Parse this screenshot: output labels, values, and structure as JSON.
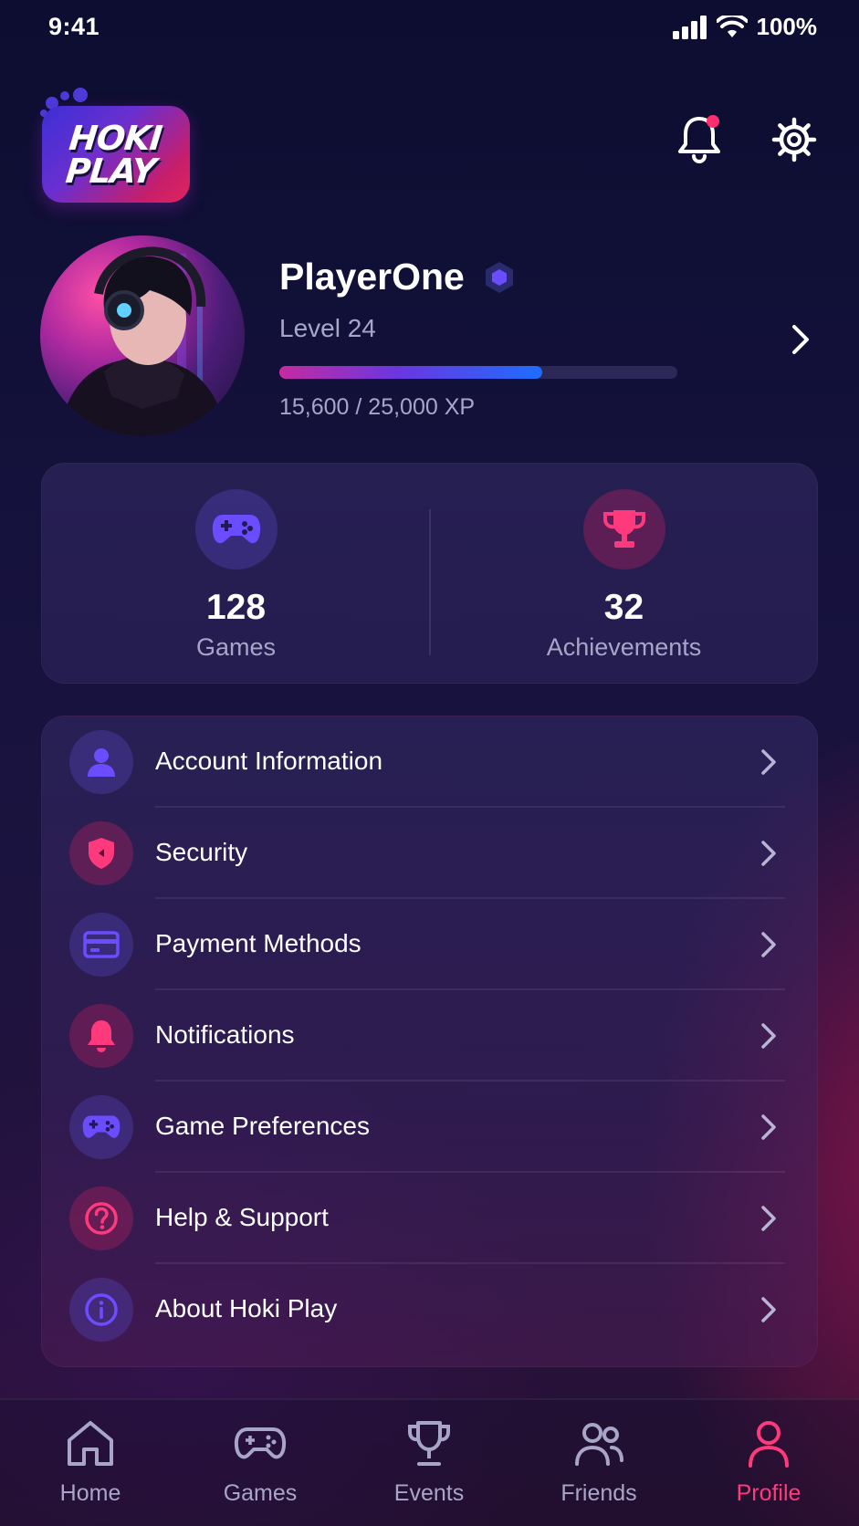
{
  "status_bar": {
    "time": "9:41",
    "battery": "100%"
  },
  "header": {
    "logo_line1": "HOKI",
    "logo_line2": "PLAY",
    "notification_unread": true
  },
  "profile": {
    "name": "PlayerOne",
    "level": "Level 24",
    "xp_text": "15,600 / 25,000 XP",
    "xp_current": 15600,
    "xp_max": 25000,
    "xp_fraction": 0.66
  },
  "stats": [
    {
      "value": "128",
      "label": "Games",
      "icon": "gamepad-icon"
    },
    {
      "value": "32",
      "label": "Achievements",
      "icon": "trophy-icon"
    }
  ],
  "menu": [
    {
      "label": "Account Information",
      "icon": "user-icon",
      "tone": "purple"
    },
    {
      "label": "Security",
      "icon": "shield-icon",
      "tone": "pink"
    },
    {
      "label": "Payment Methods",
      "icon": "credit-card-icon",
      "tone": "purple"
    },
    {
      "label": "Notifications",
      "icon": "bell-icon",
      "tone": "pink"
    },
    {
      "label": "Game Preferences",
      "icon": "gamepad-icon",
      "tone": "purple"
    },
    {
      "label": "Help & Support",
      "icon": "help-icon",
      "tone": "pink"
    },
    {
      "label": "About Hoki Play",
      "icon": "info-icon",
      "tone": "purple"
    }
  ],
  "nav": [
    {
      "label": "Home",
      "icon": "home-icon",
      "active": false
    },
    {
      "label": "Games",
      "icon": "gamepad-icon",
      "active": false
    },
    {
      "label": "Events",
      "icon": "trophy-icon",
      "active": false
    },
    {
      "label": "Friends",
      "icon": "friends-icon",
      "active": false
    },
    {
      "label": "Profile",
      "icon": "profile-icon",
      "active": true
    }
  ],
  "colors": {
    "accent_pink": "#ff3a7c",
    "accent_purple": "#6b4dff",
    "text_muted": "#a8a6c8",
    "xp_gradient": [
      "#c42ba1",
      "#6b36e0",
      "#1e6dff"
    ]
  }
}
